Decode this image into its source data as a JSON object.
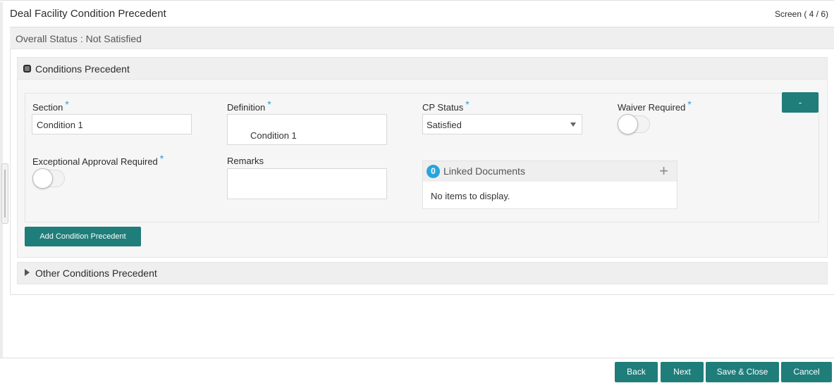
{
  "header": {
    "title": "Deal Facility Condition Precedent",
    "screen_counter": "Screen ( 4 / 6)"
  },
  "overall_status": {
    "text": "Overall Status : Not Satisfied"
  },
  "conditions_precedent": {
    "title": "Conditions Precedent",
    "required_marker": "*",
    "section": {
      "label": "Section",
      "value": "Condition 1"
    },
    "definition": {
      "label": "Definition",
      "value": "Condition 1"
    },
    "cp_status": {
      "label": "CP Status",
      "value": "Satisfied"
    },
    "waiver_required": {
      "label": "Waiver Required",
      "on": false
    },
    "exceptional_approval": {
      "label": "Exceptional Approval Required",
      "on": false
    },
    "remarks": {
      "label": "Remarks",
      "value": ""
    },
    "remove_button": "-",
    "linked_documents": {
      "count": "0",
      "title": "Linked Documents",
      "add_icon": "+",
      "empty_text": "No items to display."
    },
    "add_button": "Add Condition Precedent"
  },
  "other_conditions": {
    "title": "Other Conditions Precedent"
  },
  "footer": {
    "back": "Back",
    "next": "Next",
    "save_close": "Save & Close",
    "cancel": "Cancel"
  },
  "colors": {
    "accent": "#1f7d7a",
    "badge": "#28a5dc",
    "required": "#2e9ad0"
  }
}
